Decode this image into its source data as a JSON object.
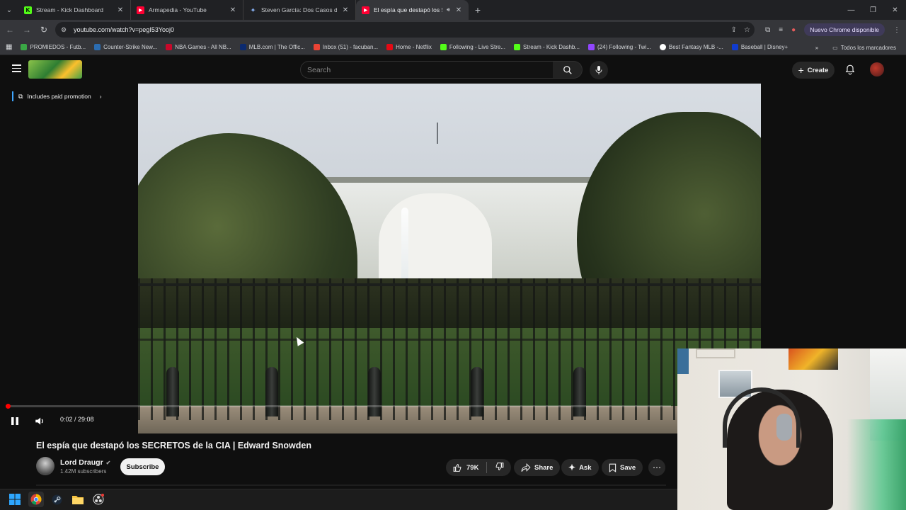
{
  "browser": {
    "tabs": [
      {
        "title": "Stream - Kick Dashboard",
        "favicon": "kick-icon",
        "color": "#53fc18",
        "active": false
      },
      {
        "title": "Armapedia - YouTube",
        "favicon": "youtube-icon",
        "color": "#ff0033",
        "active": false
      },
      {
        "title": "Steven García: Dos Casos de D",
        "favicon": "gemini-icon",
        "color": "#5b8def",
        "active": false
      },
      {
        "title": "El espía que destapó los SE",
        "favicon": "youtube-icon",
        "color": "#ff0033",
        "active": true
      }
    ],
    "url": "youtube.com/watch?v=pegI53Yooj0",
    "update_label": "Nuevo Chrome disponible",
    "bookmarks": [
      {
        "label": "PROMIEDOS - Futb...",
        "color": "#3aa845"
      },
      {
        "label": "Counter-Strike New...",
        "color": "#2b6cb0"
      },
      {
        "label": "NBA Games - All NB...",
        "color": "#c9082a"
      },
      {
        "label": "MLB.com | The Offic...",
        "color": "#0b2a6f"
      },
      {
        "label": "Inbox (51) - facuban...",
        "color": "#ea4335"
      },
      {
        "label": "Home - Netflix",
        "color": "#e50914"
      },
      {
        "label": "Following - Live Stre...",
        "color": "#53fc18"
      },
      {
        "label": "Stream - Kick Dashb...",
        "color": "#53fc18"
      },
      {
        "label": "(24) Following - Twi...",
        "color": "#9146ff"
      },
      {
        "label": "Best Fantasy MLB -...",
        "color": "#ffffff"
      },
      {
        "label": "Baseball | Disney+",
        "color": "#113ccf"
      }
    ],
    "all_bookmarks_label": "Todos los marcadores"
  },
  "youtube": {
    "search_placeholder": "Search",
    "create_label": "Create",
    "promo_label": "Includes paid promotion",
    "player": {
      "time": "0:02 / 29:08",
      "progress": 0.0011
    },
    "video": {
      "title": "El espía que destapó los SECRETOS de la CIA | Edward Snowden",
      "channel": "Lord Draugr",
      "subscribers": "1.42M subscribers",
      "subscribe_label": "Subscribe",
      "likes": "79K",
      "share_label": "Share",
      "ask_label": "Ask",
      "save_label": "Save"
    }
  }
}
